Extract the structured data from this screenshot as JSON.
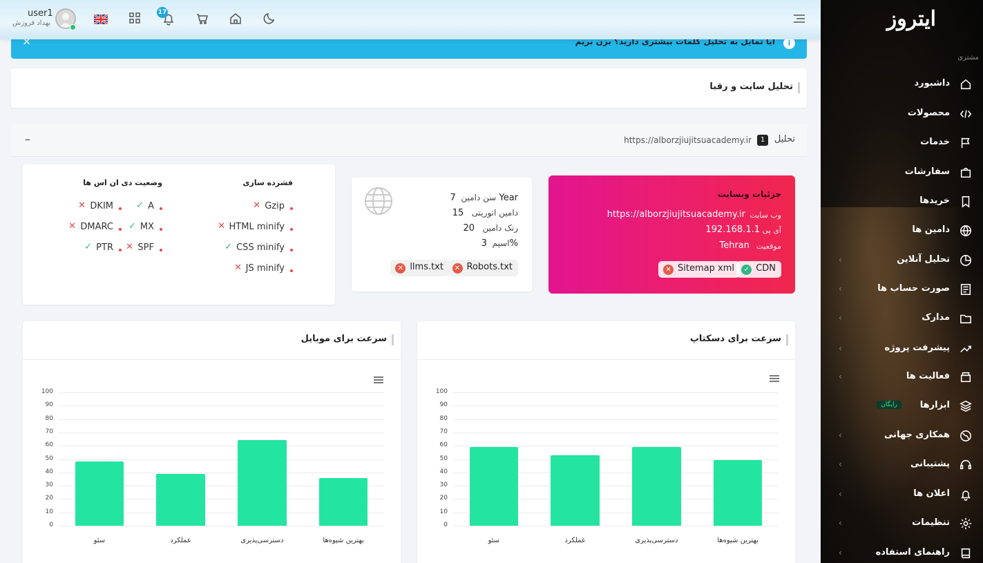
{
  "app": {
    "logo": "ایتروز",
    "section_label": "مشتری"
  },
  "sidebar": {
    "items": [
      {
        "label": "داشبورد",
        "icon": "home-icon",
        "chevron": false
      },
      {
        "label": "محصولات",
        "icon": "code-icon",
        "chevron": false
      },
      {
        "label": "خدمات",
        "icon": "flag-icon",
        "chevron": false
      },
      {
        "label": "سفارشات",
        "icon": "shopping-bag-icon",
        "chevron": false
      },
      {
        "label": "خریدها",
        "icon": "bookmark-icon",
        "chevron": false
      },
      {
        "label": "دامین ها",
        "icon": "globe-icon",
        "chevron": false
      },
      {
        "label": "تحلیل آنلاین",
        "icon": "pie-chart-icon",
        "chevron": true
      },
      {
        "label": "صورت حساب ها",
        "icon": "invoice-icon",
        "chevron": true
      },
      {
        "label": "مدارک",
        "icon": "folder-icon",
        "chevron": true
      },
      {
        "label": "پیشرفت پروژه",
        "icon": "trending-up-icon",
        "chevron": true
      },
      {
        "label": "فعالیت ها",
        "icon": "box-icon",
        "chevron": true
      },
      {
        "label": "ابزارها",
        "icon": "layers-icon",
        "chevron": false,
        "badge": "رایگان"
      },
      {
        "label": "همکاری جهانی",
        "icon": "world-icon",
        "chevron": true
      },
      {
        "label": "پشتیبانی",
        "icon": "headset-icon",
        "chevron": true
      },
      {
        "label": "اعلان ها",
        "icon": "bell-icon",
        "chevron": true
      },
      {
        "label": "تنظیمات",
        "icon": "gear-icon",
        "chevron": true
      },
      {
        "label": "راهنمای استفاده",
        "icon": "book-icon",
        "chevron": true
      }
    ]
  },
  "topbar": {
    "username": "user1",
    "role": "بهداد فروزش",
    "notifications": "17",
    "icons": [
      "flag-uk-icon",
      "apps-grid-icon",
      "bell-icon",
      "cart-icon",
      "home-icon",
      "moon-icon",
      "menu-icon"
    ]
  },
  "alert": {
    "text": "آیا تمایل به تحلیل کلمات بیشتری دارید؟  بزن بریم",
    "close": "×",
    "info": "i"
  },
  "page": {
    "title": "تحلیل سایت و رقبا"
  },
  "analysis": {
    "label": "تحلیل",
    "index": "1",
    "url": "https://alborzjiujitsuacademy.ir",
    "collapse": "–"
  },
  "details": {
    "title": "جزئیات وبسایت",
    "rows": [
      {
        "label": "وب سایت",
        "value": "https://alborzjiujitsuacademy.ir"
      },
      {
        "label": "آی پی",
        "value": "192.168.1.1"
      },
      {
        "label": "موقعیت",
        "value": "Tehran"
      }
    ],
    "chips": [
      {
        "label": "CDN",
        "ok": true
      },
      {
        "label": "Sitemap xml",
        "ok": false
      }
    ]
  },
  "domain_stats": {
    "rows": [
      {
        "label": "سن دامین",
        "value": "7 Year"
      },
      {
        "label": "دامین اتوریتی",
        "value": "15"
      },
      {
        "label": "رنک دامین",
        "value": "20"
      },
      {
        "label": "اسپم",
        "value": "3%"
      }
    ],
    "chips": [
      {
        "label": "Robots.txt",
        "ok": false
      },
      {
        "label": "llms.txt",
        "ok": false
      }
    ]
  },
  "compression": {
    "title": "فشرده سازی",
    "items": [
      {
        "label": "Gzip",
        "ok": false
      },
      {
        "label": "HTML minify",
        "ok": false
      },
      {
        "label": "CSS minify",
        "ok": true
      },
      {
        "label": "JS minify",
        "ok": false
      }
    ]
  },
  "dns": {
    "title": "وضعیت دی ان اس ها",
    "items": [
      {
        "label": "A",
        "ok": true
      },
      {
        "label": "DKIM",
        "ok": false
      },
      {
        "label": "MX",
        "ok": true
      },
      {
        "label": "DMARC",
        "ok": false
      },
      {
        "label": "SPF",
        "ok": false
      },
      {
        "label": "PTR",
        "ok": true
      }
    ]
  },
  "chart_data": [
    {
      "type": "bar",
      "title": "سرعت برای دسکتاپ",
      "categories": [
        "بهترین شیوه‌ها",
        "دسترسی‌پذیری",
        "عملکرد",
        "سئو"
      ],
      "values": [
        49,
        59,
        53,
        59
      ],
      "ylim": [
        0,
        100
      ],
      "yticks": [
        0,
        10,
        20,
        30,
        40,
        50,
        60,
        70,
        80,
        90,
        100
      ],
      "grid": true
    },
    {
      "type": "bar",
      "title": "سرعت برای موبایل",
      "categories": [
        "بهترین شیوه‌ها",
        "دسترسی‌پذیری",
        "عملکرد",
        "سئو"
      ],
      "values": [
        36,
        64,
        39,
        48
      ],
      "ylim": [
        0,
        100
      ],
      "yticks": [
        0,
        10,
        20,
        30,
        40,
        50,
        60,
        70,
        80,
        90,
        100
      ],
      "grid": true
    }
  ],
  "colors": {
    "accent": "#23b6e6",
    "bar": "#24e4a1",
    "detail_gradient_start": "#e2148f",
    "detail_gradient_end": "#f0264d"
  }
}
